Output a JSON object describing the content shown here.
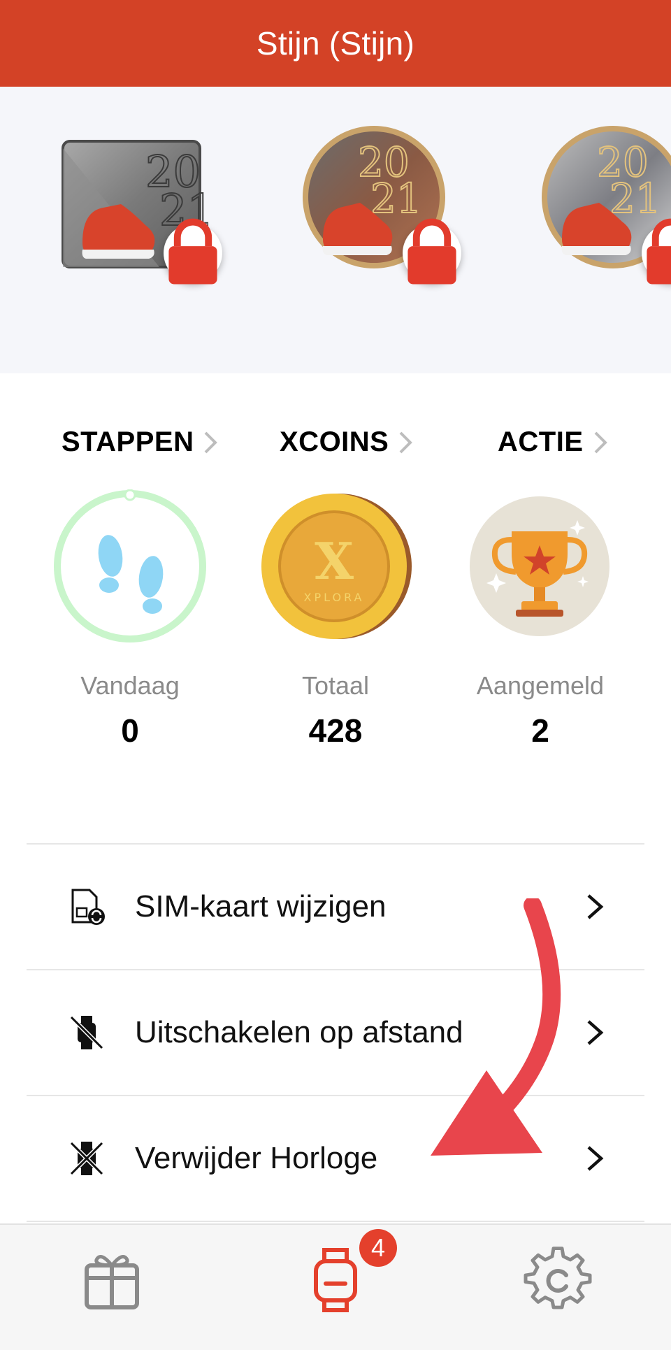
{
  "header": {
    "title": "Stijn (Stijn)"
  },
  "medals": [
    {
      "name": "silver-square",
      "locked": true
    },
    {
      "name": "bronze-round",
      "locked": true
    },
    {
      "name": "silver-round",
      "locked": true
    }
  ],
  "stats": [
    {
      "header": "STAPPEN",
      "label": "Vandaag",
      "value": "0",
      "icon": "footprints-icon"
    },
    {
      "header": "XCOINS",
      "label": "Totaal",
      "value": "428",
      "icon": "xcoin-icon"
    },
    {
      "header": "ACTIE",
      "label": "Aangemeld",
      "value": "2",
      "icon": "trophy-icon"
    }
  ],
  "menu": {
    "items": [
      {
        "label": "SIM-kaart wijzigen",
        "icon": "sim-card-icon"
      },
      {
        "label": "Uitschakelen op afstand",
        "icon": "watch-off-icon"
      },
      {
        "label": "Verwijder Horloge",
        "icon": "watch-remove-icon"
      }
    ]
  },
  "tabbar": {
    "tabs": [
      {
        "icon": "gift-icon"
      },
      {
        "icon": "watch-icon",
        "active": true
      },
      {
        "icon": "settings-icon"
      }
    ],
    "watch_badge": "4"
  },
  "colors": {
    "brand": "#d34226",
    "badge": "#e4402c",
    "annotation_arrow": "#e8454c"
  }
}
